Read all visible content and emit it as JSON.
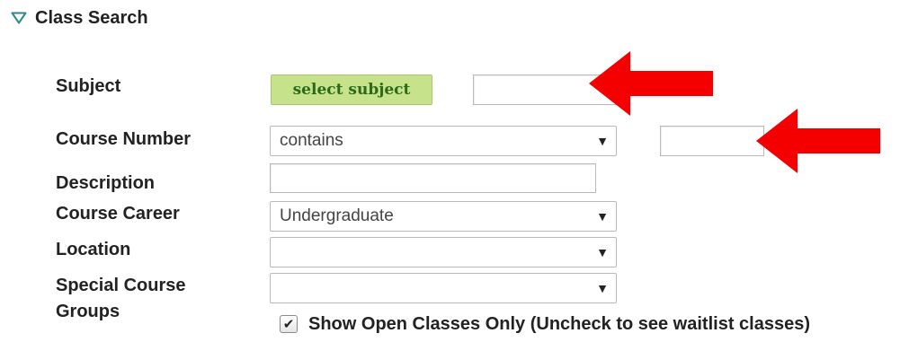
{
  "section": {
    "title": "Class Search",
    "icon": "triangle-down-icon"
  },
  "fields": {
    "subject": {
      "label": "Subject",
      "button_label": "select subject",
      "input_value": ""
    },
    "course_number": {
      "label": "Course Number",
      "operator": "contains",
      "input_value": ""
    },
    "description": {
      "label": "Description",
      "input_value": ""
    },
    "course_career": {
      "label": "Course Career",
      "selected": "Undergraduate"
    },
    "location": {
      "label": "Location",
      "selected": ""
    },
    "special_course_groups": {
      "label_line1": "Special Course",
      "label_line2": "Groups",
      "selected": ""
    }
  },
  "open_classes": {
    "checked": true,
    "label": "Show Open Classes Only (Uncheck to see waitlist classes)"
  },
  "select_arrow_glyph": "▼",
  "check_glyph": "✔",
  "colors": {
    "annotation_arrow": "#f40000",
    "button_bg": "#c6e28b",
    "button_text": "#2b6a18",
    "header_triangle": "#2e8a8a"
  }
}
